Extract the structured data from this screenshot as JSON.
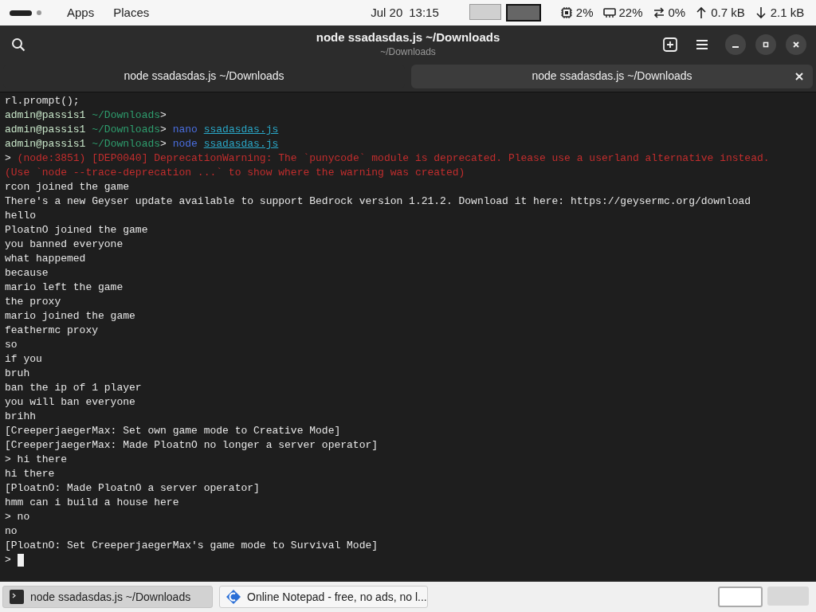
{
  "top_bar": {
    "menus": [
      "Apps",
      "Places"
    ],
    "date": "Jul 20",
    "time": "13:15",
    "workspaces": [
      {
        "selected": false
      },
      {
        "selected": true
      }
    ],
    "indicators": [
      {
        "kind": "cpu",
        "text": "2%"
      },
      {
        "kind": "memory",
        "text": "22%"
      },
      {
        "kind": "swap",
        "text": "0%"
      },
      {
        "kind": "upload",
        "text": "0.7 kB"
      },
      {
        "kind": "download",
        "text": "2.1 kB"
      }
    ]
  },
  "window": {
    "title": "node ssadasdas.js ~/Downloads",
    "subtitle": "~/Downloads"
  },
  "tabs": [
    {
      "label": "node ssadasdas.js ~/Downloads",
      "selected": false
    },
    {
      "label": "node ssadasdas.js ~/Downloads",
      "selected": true
    }
  ],
  "terminal": {
    "lines": [
      "rl.prompt();",
      {
        "segments": [
          {
            "kind": "user",
            "text": "admin@passis1"
          },
          {
            "kind": "path",
            "text": " ~/Downloads"
          },
          {
            "kind": "plain",
            "text": ">"
          }
        ]
      },
      {
        "segments": [
          {
            "kind": "user",
            "text": "admin@passis1"
          },
          {
            "kind": "path",
            "text": " ~/Downloads"
          },
          {
            "kind": "plain",
            "text": "> "
          },
          {
            "kind": "command",
            "text": "nano "
          },
          {
            "kind": "file",
            "text": "ssadasdas.js"
          }
        ]
      },
      {
        "segments": [
          {
            "kind": "user",
            "text": "admin@passis1"
          },
          {
            "kind": "path",
            "text": " ~/Downloads"
          },
          {
            "kind": "plain",
            "text": "> "
          },
          {
            "kind": "command",
            "text": "node "
          },
          {
            "kind": "file",
            "text": "ssadasdas.js"
          }
        ]
      },
      {
        "segments": [
          {
            "kind": "plain",
            "text": "> "
          },
          {
            "kind": "error",
            "text": "(node:3851) [DEP0040] DeprecationWarning: The `punycode` module is deprecated. Please use a userland alternative instead."
          }
        ]
      },
      {
        "segments": [
          {
            "kind": "error",
            "text": "(Use `node --trace-deprecation ...` to show where the warning was created)"
          }
        ]
      },
      "rcon joined the game",
      "There's a new Geyser update available to support Bedrock version 1.21.2. Download it here: https://geysermc.org/download",
      "hello",
      "PloatnO joined the game",
      "you banned everyone",
      "what happemed",
      "because",
      "mario left the game",
      "the proxy",
      "mario joined the game",
      "feathermc proxy",
      "so",
      "if you",
      "bruh",
      "ban the ip of 1 player",
      "you will ban everyone",
      "brihh",
      "[CreeperjaegerMax: Set own game mode to Creative Mode]",
      "[CreeperjaegerMax: Made PloatnO no longer a server operator]",
      "> hi there",
      "hi there",
      "[PloatnO: Made PloatnO a server operator]",
      "hmm can i build a house here",
      "> no",
      "no",
      "[PloatnO: Set CreeperjaegerMax's game mode to Survival Mode]"
    ],
    "prompt": ">"
  },
  "taskbar": {
    "items": [
      {
        "kind": "terminal",
        "label": "node ssadasdas.js ~/Downloads",
        "selected": true
      },
      {
        "kind": "browser",
        "label": "Online Notepad - free, no ads, no l...",
        "selected": false
      }
    ],
    "workspaces": [
      {
        "selected": true
      },
      {
        "selected": false
      }
    ]
  }
}
